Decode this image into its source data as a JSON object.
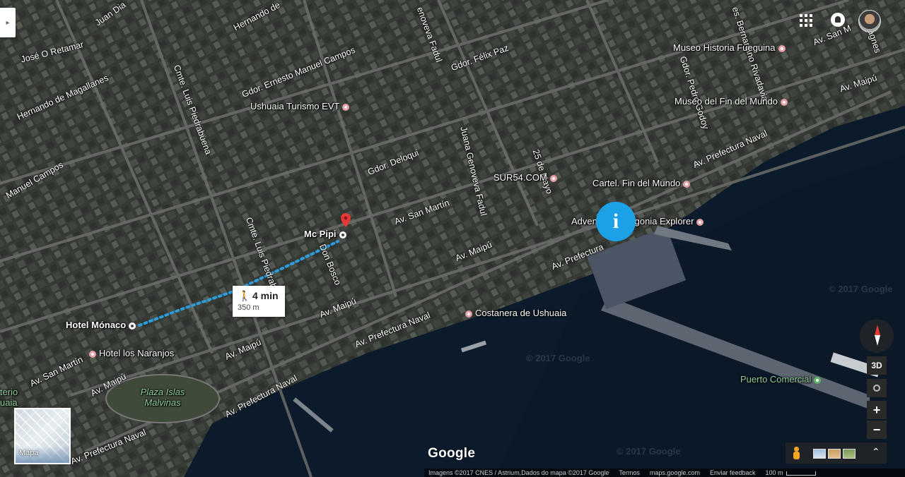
{
  "places": {
    "museo_historia": "Museo Historia Fueguina",
    "museo_fin": "Museo del Fin del Mundo",
    "ushuaia_turismo": "Ushuaia Turismo EVT",
    "sur54": "SUR54.COM",
    "cartel": "Cartel. Fin del Mundo",
    "adventure": "Adventure Patagonia Explorer",
    "mc_pipi": "Mc Pipi",
    "hotel_monaco": "Hotel Mónaco",
    "hotel_naranjos": "Hotel los Naranjos",
    "costanera": "Costanera de Ushuaia",
    "puerto": "Puerto Comercial",
    "plaza": "Plaza Islas Malvinas",
    "cementerio": "terio uaia"
  },
  "streets": {
    "juan_d": "Juan Dia",
    "hernando_top": "Hernando de",
    "hernando_mag": "Hernando de Magallanes",
    "jose_retamar": "José O Retamar",
    "manuel_campos_left": "Manuel Campos",
    "gdor_ernesto": "Gdor. Ernesto Manuel Campos",
    "gdor_felix": "Gdor. Félix Paz",
    "genoveva_top": "enoveva Fadul",
    "gdor_deloqui": "Gdor. Deloqui",
    "cmnte_luis_top": "Cmte. Luis Piedrabuena",
    "cmnte_luis_bottom": "Cmte. Luis Piedrabuena",
    "juana_genoveva": "Juana Genoveva Fadul",
    "veinticinco_mayo": "25 de Mayo",
    "av_san_martin": "Av. San Martín",
    "av_san_martin_left": "Av. San Martín",
    "av_san_martin_top": "Av. San M",
    "av_maipu_1": "Av. Maipú",
    "av_maipu_2": "Av. Maipú",
    "av_maipu_3": "Av. Maipú",
    "av_maipu_4": "Av. Maipú",
    "av_maipu_top": "Av. Maipú",
    "av_prefectura_1": "Av. Prefectura Naval",
    "av_prefectura_2": "Av. Prefectura Naval",
    "av_prefectura_3": "Av. Prefectura Naval",
    "av_prefectura_4": "Av. Prefectura",
    "av_prefectura_5": "Av. Prefectura Naval",
    "don_bosco": "Don Bosco",
    "gdor_pedro": "Gdor. Pedro Godoy",
    "bernardino": "es. Bernardino Rivadavia",
    "lagnes": "agnes"
  },
  "route": {
    "duration": "4 min",
    "distance": "350 m",
    "walk_icon": "walking-icon",
    "color": "#2d9cdb"
  },
  "controls": {
    "minimap_label": "Mapa",
    "btn_3d": "3D",
    "zoom_in": "+",
    "zoom_out": "−",
    "expand": "⌃",
    "left_tab": "▸"
  },
  "branding": {
    "logo": "Google",
    "watermark": "© 2017 Google"
  },
  "footer": {
    "attribution": "Imagens ©2017 CNES / Astrium,Dados do mapa ©2017 Google",
    "terms": "Termos",
    "domain": "maps.google.com",
    "feedback": "Enviar feedback",
    "scale": "100 m"
  },
  "colors": {
    "info_pin": "#1da1e6",
    "water": "#0b1a2b",
    "poi_pink": "#e6a0a7",
    "poi_green": "#5fb565",
    "pin_red": "#e53935"
  }
}
